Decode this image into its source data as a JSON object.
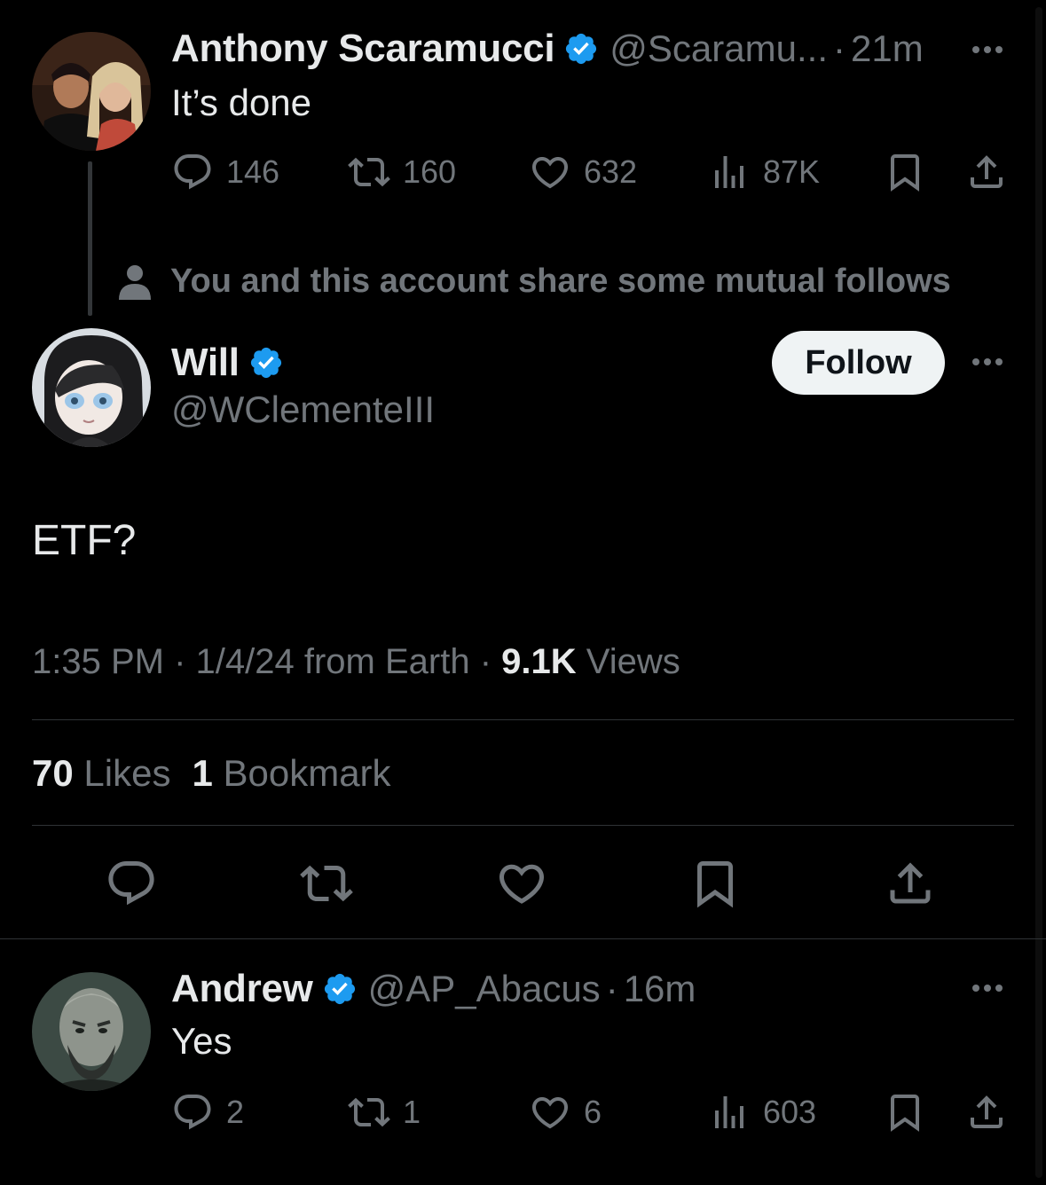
{
  "parent_tweet": {
    "author_name": "Anthony Scaramucci",
    "handle": "@Scaramu...",
    "separator": "·",
    "time": "21m",
    "text": "It’s done",
    "replies": "146",
    "reposts": "160",
    "likes": "632",
    "views": "87K"
  },
  "mutual_notice": "You and this account share some mutual follows",
  "main_tweet": {
    "author_name": "Will",
    "handle": "@WClementeIII",
    "follow_label": "Follow",
    "text": "ETF?",
    "timestamp": "1:35 PM",
    "separator": "·",
    "date": "1/4/24 from Earth",
    "views_count": "9.1K",
    "views_label": "Views",
    "likes_count": "70",
    "likes_label": "Likes",
    "bookmarks_count": "1",
    "bookmarks_label": "Bookmark"
  },
  "reply_tweet": {
    "author_name": "Andrew",
    "handle": "@AP_Abacus",
    "separator": "·",
    "time": "16m",
    "text": "Yes",
    "replies": "2",
    "reposts": "1",
    "likes": "6",
    "views": "603"
  },
  "colors": {
    "background": "#000000",
    "text_primary": "#e7e9ea",
    "text_secondary": "#71767b",
    "verified_blue": "#1d9bf0",
    "divider": "#2f3336"
  },
  "icons": [
    "verified-badge-icon",
    "more-icon",
    "reply-icon",
    "repost-icon",
    "like-icon",
    "views-icon",
    "bookmark-icon",
    "share-icon",
    "person-icon"
  ]
}
